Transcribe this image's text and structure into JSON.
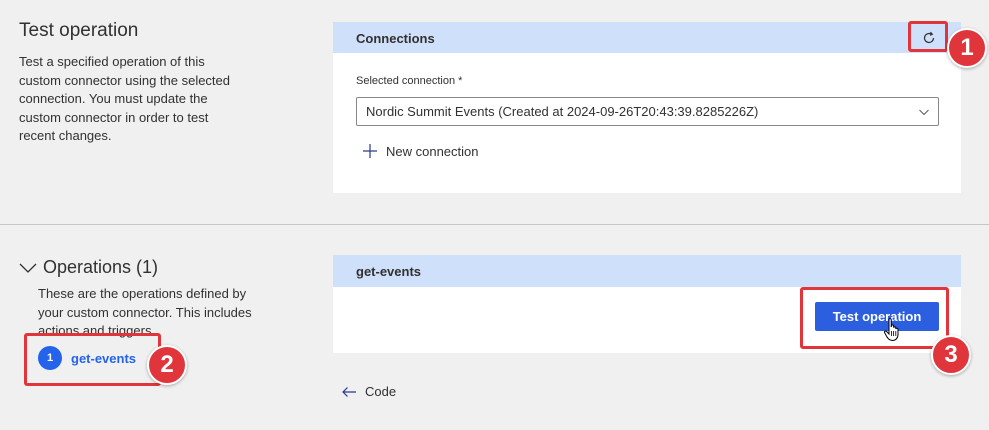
{
  "test_section": {
    "title": "Test operation",
    "description": "Test a specified operation of this custom connector using the selected connection. You must update the custom connector in order to test recent changes."
  },
  "connections": {
    "header": "Connections",
    "selected_label": "Selected connection *",
    "selected_value": "Nordic Summit Events (Created at 2024-09-26T20:43:39.8285226Z)",
    "new_connection": "New connection"
  },
  "operations": {
    "title": "Operations (1)",
    "description": "These are the operations defined by your custom connector. This includes actions and triggers.",
    "items": [
      {
        "index": "1",
        "name": "get-events"
      }
    ]
  },
  "operation_card": {
    "header": "get-events",
    "test_button": "Test operation"
  },
  "code_link": "Code",
  "annotations": {
    "badge_1": "1",
    "badge_2": "2",
    "badge_3": "3"
  },
  "colors": {
    "accent": "#2b5fe0",
    "card_header": "#cfe0fb",
    "annotation_red": "#e0353b",
    "background": "#f0f0f0"
  },
  "icons": {
    "refresh": "refresh-icon",
    "chevron_down": "chevron-down-icon",
    "plus": "plus-icon",
    "chevron_expand": "chevron-down-icon",
    "arrow_left": "arrow-left-icon",
    "cursor": "hand-cursor-icon"
  }
}
